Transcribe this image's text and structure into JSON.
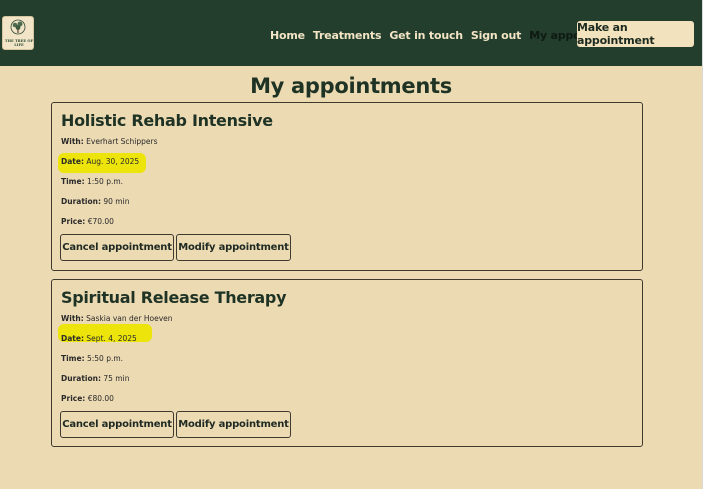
{
  "brand": {
    "logo_text": "THE TREE OF LIFE"
  },
  "nav": {
    "links": [
      {
        "label": "Home"
      },
      {
        "label": "Treatments"
      },
      {
        "label": "Get in touch"
      },
      {
        "label": "Sign out"
      },
      {
        "label": "My appointments"
      }
    ],
    "cta_label": "Make an appointment"
  },
  "page": {
    "title": "My appointments"
  },
  "labels": {
    "with": "With:",
    "date": "Date:",
    "time": "Time:",
    "duration": "Duration:",
    "price": "Price:",
    "cancel": "Cancel appointment",
    "modify": "Modify appointment"
  },
  "appointments": [
    {
      "title": "Holistic Rehab Intensive",
      "with": "Everhart Schippers",
      "date": "Aug. 30, 2025",
      "time": "1:50 p.m.",
      "duration": "90 min",
      "price": "€70.00"
    },
    {
      "title": "Spiritual Release Therapy",
      "with": "Saskia van der Hoeven",
      "date": "Sept. 4, 2025",
      "time": "5:50 p.m.",
      "duration": "75 min",
      "price": "€80.00"
    }
  ],
  "colors": {
    "navbar": "#233e2c",
    "page_background": "#ecdab3",
    "highlight": "#ece40a",
    "heading": "#1f3325"
  }
}
